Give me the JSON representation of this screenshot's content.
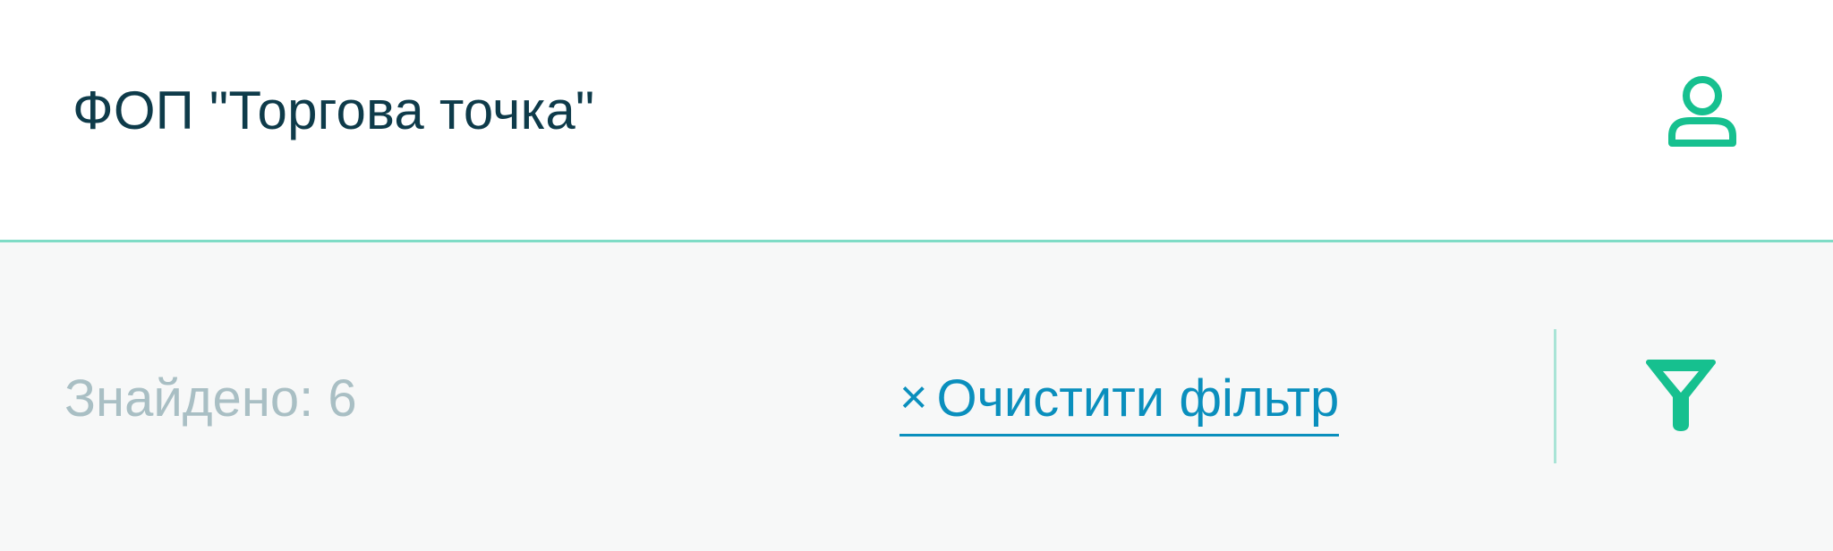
{
  "header": {
    "title": "ФОП \"Торгова точка\"",
    "profile_icon": "user-icon"
  },
  "filter_bar": {
    "found_label": "Знайдено: 6",
    "clear_filter_symbol": "×",
    "clear_filter_label": "Очистити фільтр",
    "filter_icon": "funnel-icon"
  },
  "colors": {
    "accent_green": "#16c08f",
    "link_blue": "#0a8fbd",
    "title_text": "#0e3b4a",
    "muted_text": "#a9bfc4",
    "header_border": "#7fdcc6",
    "filter_bar_bg": "#f7f8f8"
  }
}
